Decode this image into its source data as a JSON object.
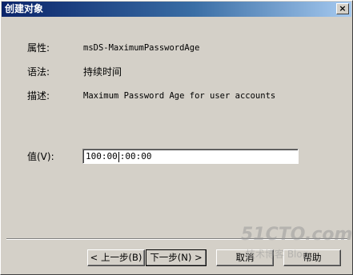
{
  "window": {
    "title": "创建对象",
    "close_label": "×"
  },
  "fields": {
    "attribute_label": "属性:",
    "attribute_value": "msDS-MaximumPasswordAge",
    "syntax_label": "语法:",
    "syntax_value": "持续时间",
    "description_label": "描述:",
    "description_value": "Maximum Password Age for user accounts"
  },
  "value_input": {
    "label": "值(V):",
    "before_cursor": "100:00",
    "after_cursor": ":00:00"
  },
  "buttons": {
    "back": "< 上一步(B)",
    "next": "下一步(N) >",
    "cancel": "取消",
    "help": "帮助"
  },
  "watermark": {
    "text": "51CTO.com",
    "subtext": "技术博客 Blog"
  }
}
